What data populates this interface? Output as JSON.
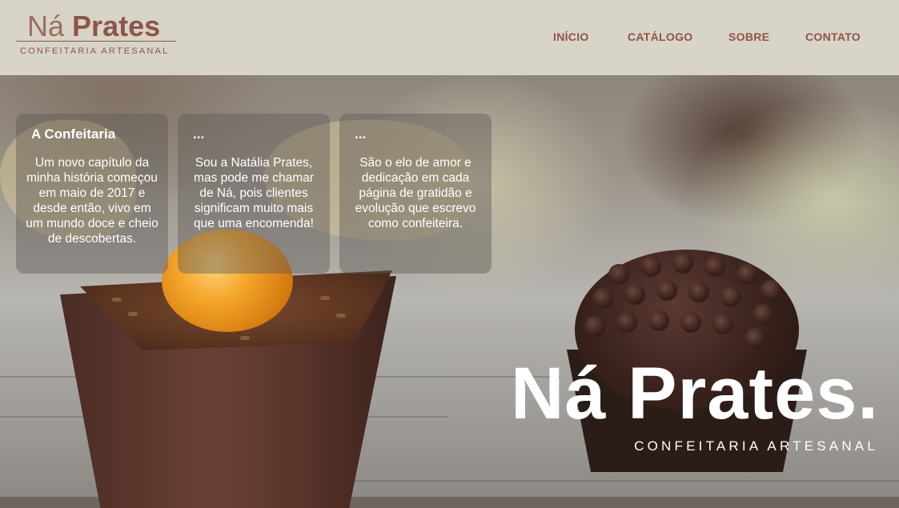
{
  "header": {
    "logo": {
      "title_light": "Ná",
      "title_bold": "Prates",
      "subtitle": "CONFEITARIA ARTESANAL"
    },
    "nav": [
      {
        "label": "INÍCIO"
      },
      {
        "label": "CATÁLOGO"
      },
      {
        "label": "SOBRE"
      },
      {
        "label": "CONTATO"
      }
    ]
  },
  "cards": [
    {
      "title": "A Confeitaria",
      "text": "Um novo capítulo da minha história começou em maio de 2017 e desde então, vivo em um mundo doce e cheio de descobertas."
    },
    {
      "title": "...",
      "text": "Sou a Natália Prates, mas pode me chamar de Ná, pois clientes significam muito mais que uma encomenda!"
    },
    {
      "title": "...",
      "text": "São o elo de amor e dedicação em cada página de gratidão e evolução que escrevo como confeiteira."
    }
  ],
  "hero": {
    "title": "Ná Prates.",
    "subtitle": "CONFEITARIA ARTESANAL"
  },
  "colors": {
    "brand": "#8d5548",
    "header_bg": "#dedacd",
    "hero_text": "#ffffff"
  }
}
